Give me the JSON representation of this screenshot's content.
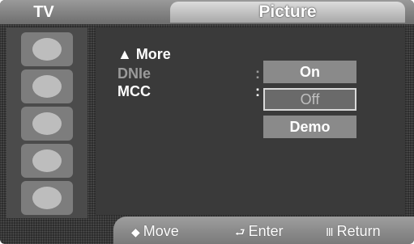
{
  "header": {
    "tv_label": "TV",
    "section_title": "Picture"
  },
  "menu": {
    "more_label": "▲ More",
    "rows": [
      {
        "label": "DNIe",
        "colon": ":"
      },
      {
        "label": "MCC",
        "colon": ":"
      }
    ],
    "options": [
      "On",
      "Off",
      "Demo"
    ],
    "selected_option": "Off"
  },
  "footer": {
    "move_icon": "◆",
    "move_label": "Move",
    "enter_icon": "⮐",
    "enter_label": "Enter",
    "return_icon": "Ⅲ",
    "return_label": "Return"
  },
  "colors": {
    "background": "#2a2a2a",
    "highlight": "#d9d9d9",
    "inactive_text": "#9a9a9a"
  },
  "sidebar": {
    "icons": [
      "picture-category-icon",
      "sound-category-icon",
      "channel-category-icon",
      "setup-category-icon",
      "input-category-icon"
    ]
  }
}
